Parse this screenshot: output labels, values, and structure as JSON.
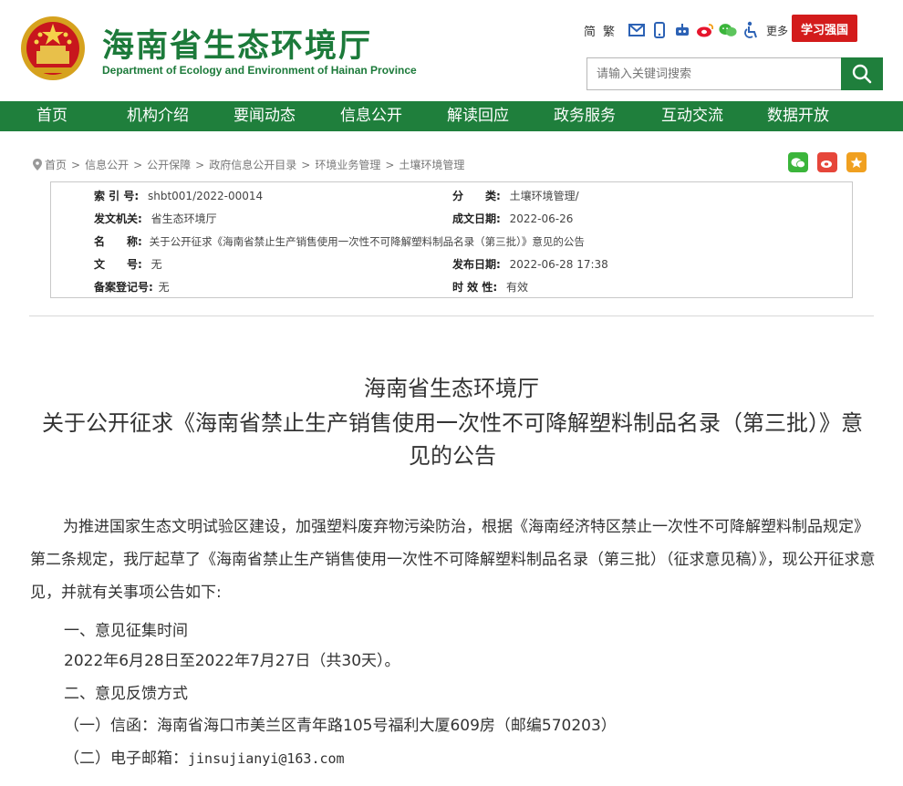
{
  "header": {
    "title": "海南省生态环境厅",
    "subtitle": "Department of Ecology and Environment of Hainan Province",
    "lang_simplified": "简",
    "lang_traditional": "繁",
    "more": "更多",
    "xuexi_label": "学习强国",
    "tool_icons": [
      "mail-icon",
      "mobile-icon",
      "robot-icon",
      "weibo-icon",
      "wechat-icon",
      "accessibility-icon"
    ]
  },
  "search": {
    "placeholder": "请输入关键词搜索"
  },
  "nav": {
    "items": [
      "首页",
      "机构介绍",
      "要闻动态",
      "信息公开",
      "解读回应",
      "政务服务",
      "互动交流",
      "数据开放"
    ]
  },
  "breadcrumb": {
    "items": [
      "首页",
      "信息公开",
      "公开保障",
      "政府信息公开目录",
      "环境业务管理",
      "土壤环境管理"
    ],
    "separator": ">"
  },
  "info": {
    "index_label": "索 引 号:",
    "index_value": "shbt001/2022-00014",
    "category_label": "分　　类:",
    "category_value": "土壤环境管理/",
    "issuer_label": "发文机关:",
    "issuer_value": "省生态环境厅",
    "created_label": "成文日期:",
    "created_value": "2022-06-26",
    "name_label": "名　　称:",
    "name_value": "关于公开征求《海南省禁止生产销售使用一次性不可降解塑料制品名录（第三批）》意见的公告",
    "docno_label": "文　　号:",
    "docno_value": "无",
    "published_label": "发布日期:",
    "published_value": "2022-06-28 17:38",
    "record_label": "备案登记号:",
    "record_value": "无",
    "validity_label": "时 效 性:",
    "validity_value": "有效"
  },
  "article": {
    "title_line1": "海南省生态环境厅",
    "title_line2": "关于公开征求《海南省禁止生产销售使用一次性不可降解塑料制品名录（第三批）》意见的公告",
    "paragraph1": "为推进国家生态文明试验区建设，加强塑料废弃物污染防治，根据《海南经济特区禁止一次性不可降解塑料制品规定》第二条规定，我厅起草了《海南省禁止生产销售使用一次性不可降解塑料制品名录（第三批）（征求意见稿）》，现公开征求意见，并就有关事项公告如下:",
    "section1": "一、意见征集时间",
    "section1_text": "2022年6月28日至2022年7月27日（共30天）。",
    "section2": "二、意见反馈方式",
    "item1": "（一）信函：海南省海口市美兰区青年路105号福利大厦609房（邮编570203）",
    "item2_label": "（二）电子邮箱：",
    "item2_value": "jinsujianyi@163.com"
  },
  "colors": {
    "brand_green": "#1f7f3c",
    "title_green": "#1c7a3a",
    "xuexi_red": "#d31b1b"
  }
}
